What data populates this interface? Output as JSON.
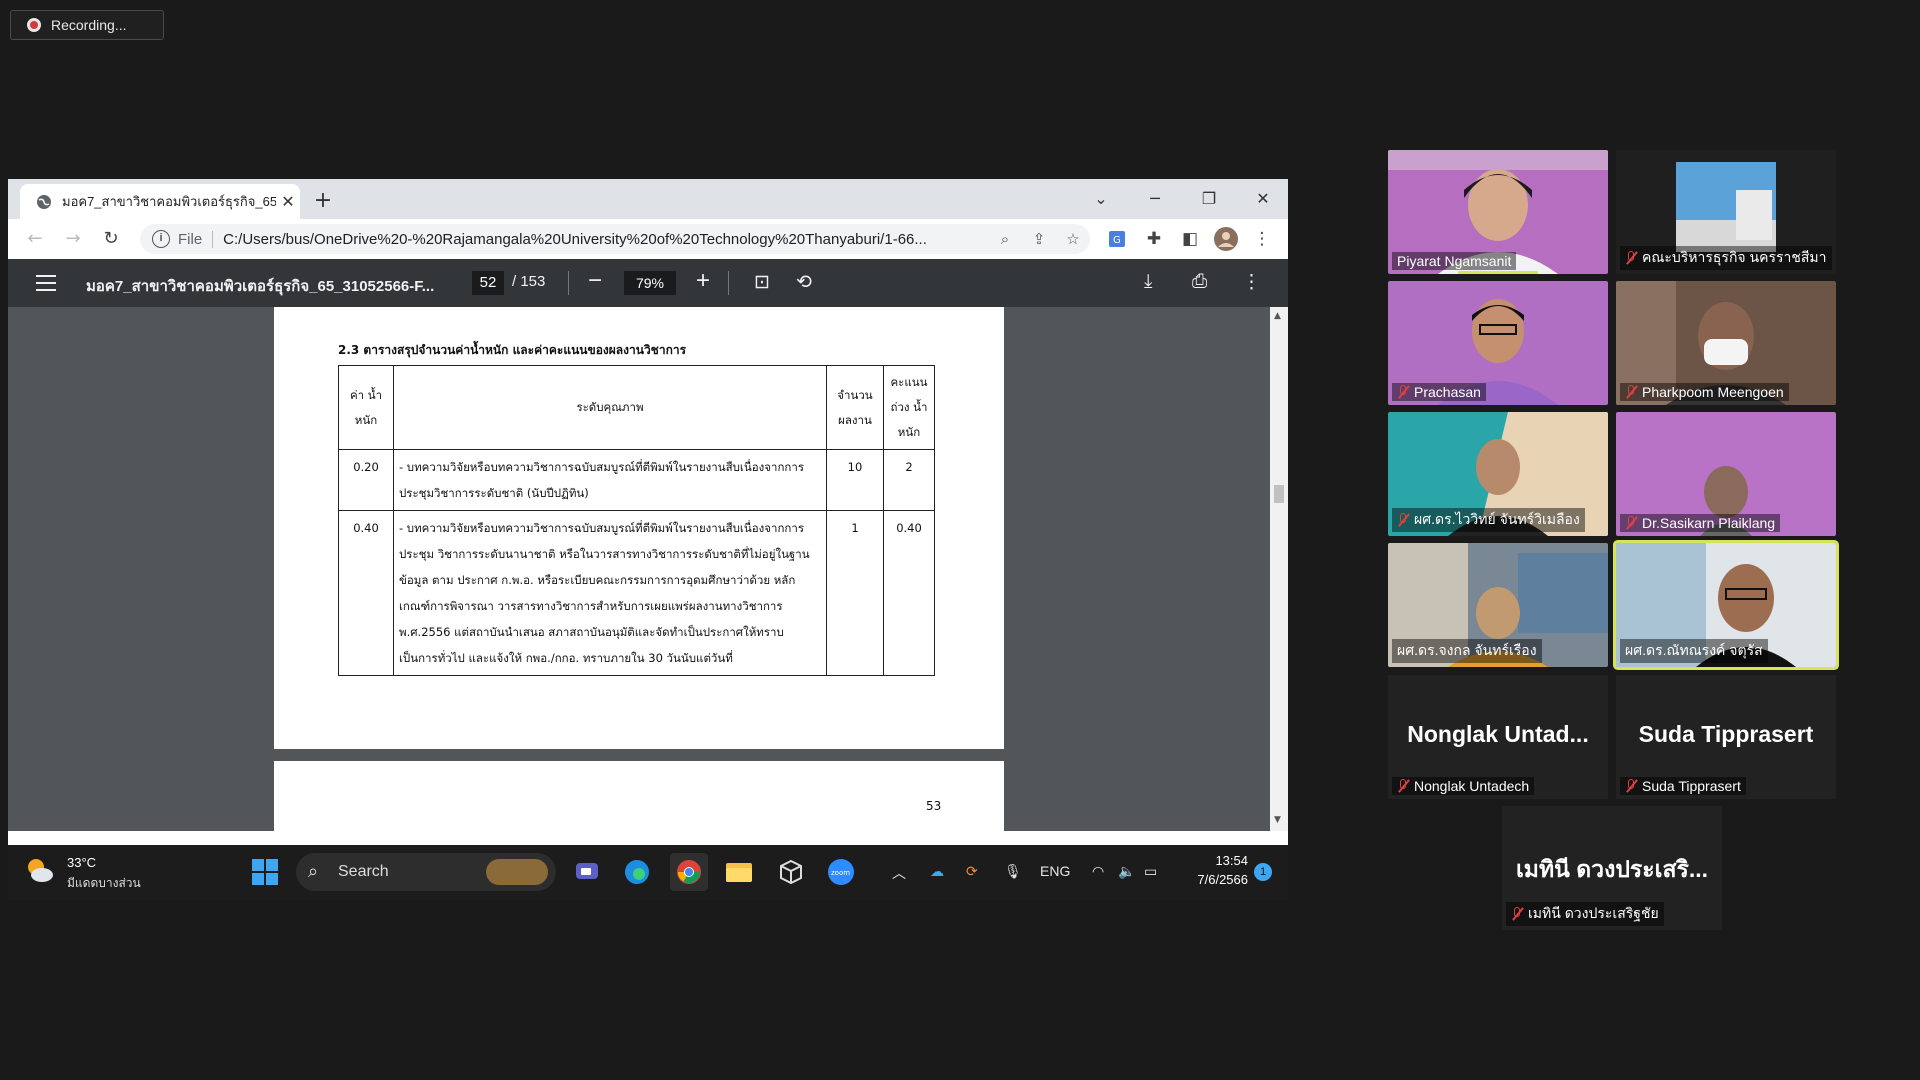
{
  "recording": {
    "label": "Recording..."
  },
  "browser": {
    "tab_title": "มอค7_สาขาวิชาคอมพิวเตอร์ธุรกิจ_65_",
    "url_scheme_label": "File",
    "url": "C:/Users/bus/OneDrive%20-%20Rajamangala%20University%20of%20Technology%20Thanyaburi/1-66..."
  },
  "pdf": {
    "title": "มอค7_สาขาวิชาคอมพิวเตอร์ธุรกิจ_65_31052566-F...",
    "current_page": "52",
    "total_pages": "/ 153",
    "zoom": "79%",
    "heading": "2.3 ตารางสรุปจำนวนค่าน้ำหนัก และค่าคะแนนของผลงานวิชาการ",
    "table": {
      "headers": [
        "ค่า น้ำหนัก",
        "ระดับคุณภาพ",
        "จำนวน ผลงาน",
        "คะแนน ถ่วง น้ำหนัก"
      ],
      "rows": [
        {
          "weight": "0.20",
          "quality": "- บทความวิจัยหรือบทความวิชาการฉบับสมบูรณ์ที่ตีพิมพ์ในรายงานสืบเนื่องจากการประชุมวิชาการระดับชาติ (นับปีปฏิทิน)",
          "count": "10",
          "score": "2"
        },
        {
          "weight": "0.40",
          "quality": "- บทความวิจัยหรือบทความวิชาการฉบับสมบูรณ์ที่ตีพิมพ์ในรายงานสืบเนื่องจากการประชุม วิชาการระดับนานาชาติ หรือในวารสารทางวิชาการระดับชาติที่ไม่อยู่ในฐานข้อมูล ตาม ประกาศ ก.พ.อ. หรือระเบียบคณะกรรมการการอุดมศึกษาว่าด้วย หลักเกณฑ์การพิจารณา วารสารทางวิชาการสำหรับการเผยแพร่ผลงานทางวิชาการ พ.ศ.2556 แต่สถาบันนำเสนอ สภาสถาบันอนุมัติและจัดทำเป็นประกาศให้ทราบเป็นการทั่วไป และแจ้งให้ กพอ./กกอ. ทราบภายใน 30 วันนับแต่วันที่",
          "count": "1",
          "score": "0.40"
        }
      ]
    },
    "next_page_number": "53"
  },
  "taskbar": {
    "temperature": "33°C",
    "weather_text": "มีแดดบางส่วน",
    "search_label": "Search",
    "language": "ENG",
    "time": "13:54",
    "date": "7/6/2566",
    "notification_count": "1"
  },
  "participants": [
    {
      "name": "Piyarat Ngamsanit",
      "muted": false
    },
    {
      "name": "คณะบริหารธุรกิจ นครราชสีมา",
      "muted": true
    },
    {
      "name": "Prachasan",
      "muted": true
    },
    {
      "name": "Pharkpoom Meengoen",
      "muted": true
    },
    {
      "name": "ผศ.ดร.ไววิทย์ จันทร์วิเมลือง",
      "muted": true
    },
    {
      "name": "Dr.Sasikarn Plaiklang",
      "muted": true
    },
    {
      "name": "ผศ.ดร.จงกล จันทร์เรือง",
      "muted": false
    },
    {
      "name": "ผศ.ดร.ณัทณรงค์ จตุรัส",
      "muted": false
    },
    {
      "name": "Nonglak Untadech",
      "display": "Nonglak Untad...",
      "muted": true
    },
    {
      "name": "Suda Tipprasert",
      "display": "Suda Tipprasert",
      "muted": true
    },
    {
      "name": "เมทินี ดวงประเสริฐชัย",
      "display": "เมทินี ดวงประเสริ...",
      "muted": true
    }
  ]
}
